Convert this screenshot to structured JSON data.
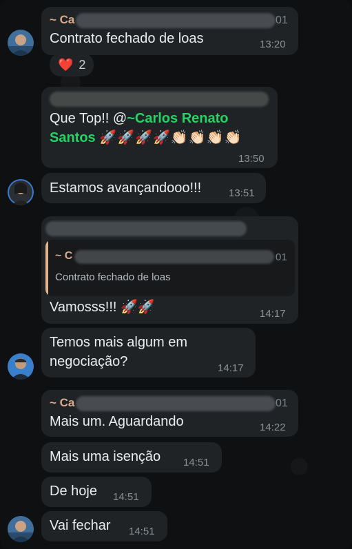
{
  "colors": {
    "bubble": "#1f2326",
    "text": "#e9edef",
    "time": "#8a9196",
    "mention": "#25d366",
    "sender_name": "#d9a98b"
  },
  "messages": [
    {
      "sender_prefix": "~ Ca",
      "sender_tail": "01",
      "text": "Contrato fechado de loas",
      "time": "13:20",
      "reaction": {
        "emoji": "❤️",
        "count": "2"
      }
    },
    {
      "text_prefix": "Que Top!! @",
      "mention": "~Carlos Renato",
      "mention_line2": "Santos",
      "emojis": "🚀🚀🚀🚀👏🏻👏🏻👏🏻👏🏻",
      "time": "13:50"
    },
    {
      "text": "Estamos avançandooo!!!",
      "time": "13:51"
    },
    {
      "quote_sender": "~ C",
      "quote_tail": "01",
      "quote_text": "Contrato fechado de loas",
      "text": "Vamosss!!! 🚀🚀",
      "time": "14:17"
    },
    {
      "text_line1": "Temos mais algum em",
      "text_line2": "negociação?",
      "time": "14:17"
    },
    {
      "sender_prefix": "~ Ca",
      "sender_tail": "01",
      "text": "Mais um. Aguardando",
      "time": "14:22"
    },
    {
      "text": "Mais uma isenção",
      "time": "14:51"
    },
    {
      "text": "De hoje",
      "time": "14:51"
    },
    {
      "text": "Vai fechar",
      "time": "14:51"
    }
  ]
}
